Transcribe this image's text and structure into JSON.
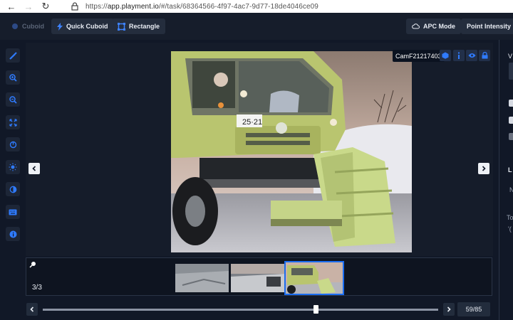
{
  "browser": {
    "url_prefix": "https://",
    "url_host": "app.playment.io",
    "url_path": "/#/task/68364566-4f97-4ac7-9d77-18de4046ce09"
  },
  "toolbar": {
    "cuboid_label": "Cuboid",
    "quick_cuboid_label": "Quick Cuboid",
    "rectangle_label": "Rectangle",
    "apc_mode_label": "APC Mode",
    "point_intensity_label": "Point Intensity"
  },
  "viewer": {
    "camera_label": "CamF21217403"
  },
  "thumbnails": {
    "counter": "3/3",
    "count": 3,
    "active_index": 2
  },
  "timeline": {
    "frame_label": "59/85",
    "current_frame": 59,
    "total_frames": 85
  },
  "right_panel": {
    "partial_labels": [
      "V",
      "L",
      "N",
      "To",
      "'("
    ]
  },
  "colors": {
    "accent": "#1a6cf0",
    "background": "#111827",
    "panel": "#161d2b"
  }
}
